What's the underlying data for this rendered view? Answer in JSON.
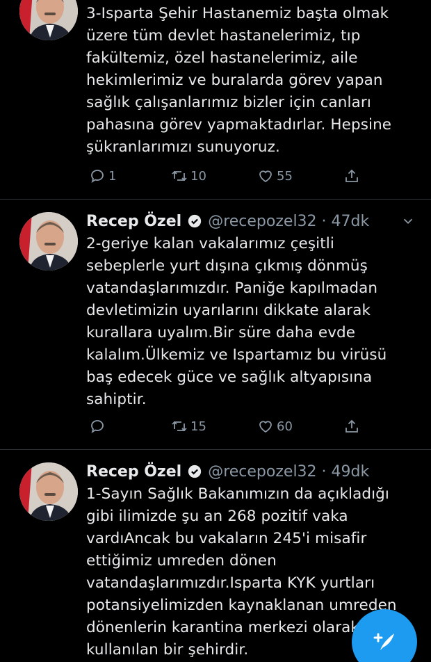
{
  "tweets": [
    {
      "name": "",
      "handle": "",
      "text": "3-Isparta Şehir Hastanemiz başta olmak\nüzere tüm devlet hastanelerimiz, tıp\nfakültemiz, özel hastanelerimiz, aile\nhekimlerimiz ve buralarda görev yapan\nsağlık çalışanlarımız bizler için canları\npahasına görev yapmaktadırlar. Hepsine\nşükranlarımızı sunuyoruz.",
      "replies": "1",
      "retweets": "10",
      "likes": "55"
    },
    {
      "name": "Recep Özel",
      "handle": "@recepozel32 · 47dk",
      "text": "2-geriye kalan vakalarımız çeşitli\nsebeplerle yurt dışına çıkmış dönmüş\nvatandaşlarımızdır. Paniğe kapılmadan\ndevletimizin uyarılarını dikkate alarak\nkurallara uyalım.Bir süre daha evde\nkalalım.Ülkemiz ve Ispartamız bu virüsü\nbaş edecek güce ve sağlık altyapısına\nsahiptir.",
      "replies": "",
      "retweets": "15",
      "likes": "60"
    },
    {
      "name": "Recep Özel",
      "handle": "@recepozel32 · 49dk",
      "text": "1-Sayın Sağlık Bakanımızın da açıkladığı\ngibi ilimizde şu an 268 pozitif vaka\nvardıAncak bu vakaların 245'i misafir\nettiğimiz umreden dönen\nvatandaşlarımızdır.Isparta KYK yurtları\npotansiyelimizden kaynaklanan umreden\ndönenlerin  karantina merkezi olarak\nkullanılan bir şehirdir.",
      "replies": "",
      "retweets": "",
      "likes": ""
    }
  ],
  "colors": {
    "background": "#000000",
    "text": "#e7e9ea",
    "secondary": "#8b98a5",
    "accent": "#1d9bf0",
    "divider": "#2f3336"
  },
  "icons": {
    "reply": "reply-icon",
    "retweet": "retweet-icon",
    "like": "like-icon",
    "share": "share-icon",
    "verified": "verified-badge-icon",
    "more": "chevron-down-icon",
    "compose": "compose-tweet-icon"
  }
}
